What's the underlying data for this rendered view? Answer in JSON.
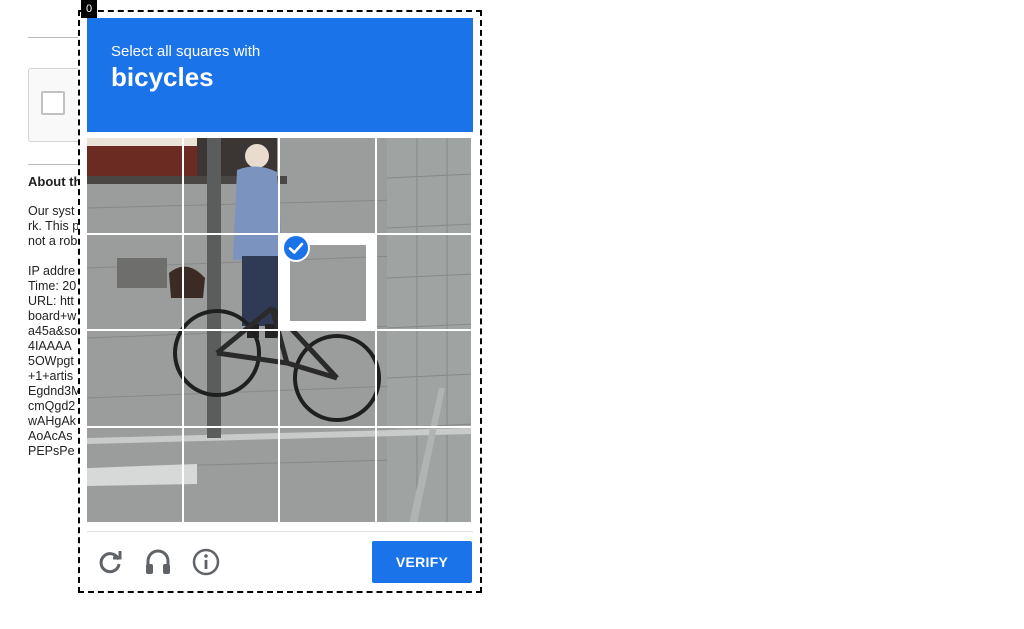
{
  "page": {
    "about_title": "About th",
    "body_lines": [
      "Our syst",
      "rk. This p",
      "not a rob",
      "",
      "IP addre",
      "Time: 20",
      "URL: htt",
      "board+w",
      "a45a&so",
      "4IAAAA",
      "5OWpgt",
      "+1+artis",
      "Egdnd3M",
      "cmQgd2",
      "wAHgAk",
      "AoAcAs",
      "PEPsPe"
    ]
  },
  "frame_badge": "0",
  "challenge": {
    "instruction": "Select all squares with",
    "target": "bicycles",
    "selected_tile": 6,
    "verify_label": "VERIFY"
  },
  "icons": {
    "reload": "reload-icon",
    "audio": "headphones-icon",
    "info": "info-icon",
    "check": "check-circle-icon"
  },
  "colors": {
    "accent": "#1a73e8",
    "header_text": "#ffffff"
  }
}
